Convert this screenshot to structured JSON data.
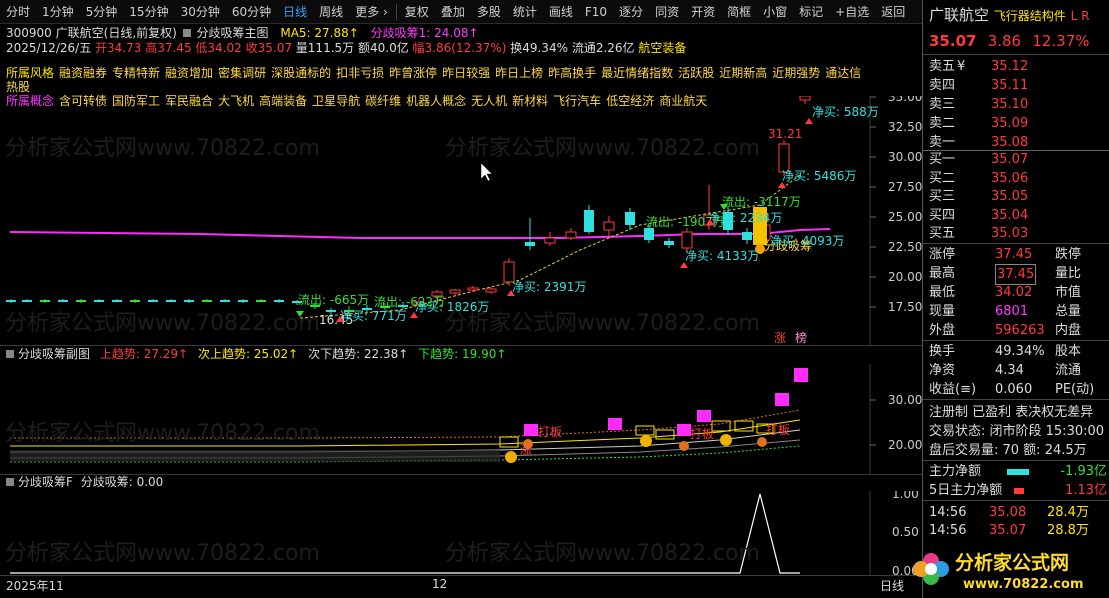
{
  "toolbar": {
    "items": [
      "分时",
      "1分钟",
      "5分钟",
      "15分钟",
      "30分钟",
      "60分钟",
      "日线",
      "周线",
      "更多 ›",
      "复权",
      "叠加",
      "多股",
      "统计",
      "画线",
      "F10",
      "逐分",
      "同资",
      "开资",
      "简框",
      "小窗",
      "标记",
      "+自选",
      "返回"
    ],
    "active_index": 6
  },
  "stock": {
    "code": "300900",
    "name": "广联航空",
    "mode": "(日线,前复权)",
    "date": "2025/12/26/五",
    "open": "开34.73",
    "high": "高37.45",
    "low": "低34.02",
    "close": "收35.07",
    "volume": "量111.5万",
    "amount": "额40.0亿",
    "amplitude": "幅3.86(12.37%)",
    "turnover": "换49.34%",
    "float": "流通2.26亿",
    "sector": "航空装备"
  },
  "main_indicator": {
    "name": "分歧吸筹主图",
    "ma5": "MA5: 27.88↑",
    "xichou": "分歧吸筹1: 24.08↑"
  },
  "concepts_line1": [
    "所属风格",
    "融资融券",
    "专精特新",
    "融资增加",
    "密集调研",
    "深股通标的",
    "扣非亏损",
    "昨曾涨停",
    "昨日较强",
    "昨日上榜",
    "昨高换手",
    "最近情绪指数",
    "活跃股",
    "近期新高",
    "近期强势",
    "通达信热股"
  ],
  "concepts_line2": [
    "所属概念",
    "含可转债",
    "国防军工",
    "军民融合",
    "大飞机",
    "高端装备",
    "卫星导航",
    "碳纤维",
    "机器人概念",
    "无人机",
    "新材料",
    "飞行汽车",
    "低空经济",
    "商业航天"
  ],
  "main_chart": {
    "y_ticks": [
      "35.00",
      "32.50",
      "30.00",
      "27.50",
      "25.00",
      "22.50",
      "20.00",
      "17.50"
    ],
    "annotations": [
      "流出: -665万",
      "流出: -622万",
      "16.45",
      "净买: 771万",
      "净买: 1826万",
      "净买: 2391万",
      "流出: -1907万",
      "净买: 2234万",
      "流出: -3117万",
      "净买: 4133万",
      "净买: 5486万",
      "净买: 588万",
      "31.21",
      "分歧吸筹",
      "净买: 4093万",
      "涨",
      "榜"
    ]
  },
  "sub_indicator": {
    "name": "分歧吸筹副图",
    "up_trend": "上趋势: 27.29↑",
    "next_up": "次上趋势: 25.02↑",
    "next_down": "次下趋势: 22.38↑",
    "down_trend": "下趋势: 19.90↑",
    "y_ticks": [
      "30.00",
      "20.00"
    ],
    "labels": [
      "打板",
      "打板",
      "打板",
      "打板",
      "涨"
    ]
  },
  "f_indicator": {
    "name": "分歧吸筹F",
    "value": "分歧吸筹: 0.00",
    "y_ticks": [
      "1.00",
      "0.50",
      "0.00"
    ]
  },
  "x_axis": {
    "labels": [
      "2025年11",
      "12"
    ],
    "right_label": "日线"
  },
  "watermark": "分析家公式网www.70822.com",
  "logo": {
    "title": "分析家公式网",
    "url": "www.70822.com"
  },
  "quote": {
    "name": "广联航空",
    "tag": "飞行器结构件",
    "flags": "L R",
    "price": "35.07",
    "change": "3.86",
    "pct": "12.37%",
    "asks": [
      {
        "label": "卖五",
        "suffix": "¥",
        "price": "35.12"
      },
      {
        "label": "卖四",
        "suffix": "",
        "price": "35.11"
      },
      {
        "label": "卖三",
        "suffix": "",
        "price": "35.10"
      },
      {
        "label": "卖二",
        "suffix": "",
        "price": "35.09"
      },
      {
        "label": "卖一",
        "suffix": "",
        "price": "35.08"
      }
    ],
    "bids": [
      {
        "label": "买一",
        "price": "35.07"
      },
      {
        "label": "买二",
        "price": "35.06"
      },
      {
        "label": "买三",
        "price": "35.05"
      },
      {
        "label": "买四",
        "price": "35.04"
      },
      {
        "label": "买五",
        "price": "35.03"
      }
    ],
    "stats": [
      {
        "l1": "涨停",
        "v1": "37.45",
        "l2": "跌停",
        "v2": ""
      },
      {
        "l1": "最高",
        "v1": "37.45",
        "l2": "量比",
        "v2": ""
      },
      {
        "l1": "最低",
        "v1": "34.02",
        "l2": "市值",
        "v2": ""
      },
      {
        "l1": "现量",
        "v1": "6801",
        "l2": "总量",
        "v2": ""
      },
      {
        "l1": "外盘",
        "v1": "596263",
        "l2": "内盘",
        "v2": ""
      }
    ],
    "stats2": [
      {
        "l1": "换手",
        "v1": "49.34%",
        "l2": "股本"
      },
      {
        "l1": "净资",
        "v1": "4.34",
        "l2": "流通"
      },
      {
        "l1": "收益(≡)",
        "v1": "0.060",
        "l2": "PE(动)"
      }
    ],
    "registration": "注册制 已盈利 表决权无差异",
    "trade_status": "交易状态: 闭市阶段 15:30:00",
    "after_hours": "盘后交易量: 70  额: 24.5万",
    "main_net": {
      "label": "主力净额",
      "value": "-1.93亿"
    },
    "main_net5": {
      "label": "5日主力净额",
      "value": "1.13亿"
    },
    "ticks": [
      {
        "time": "14:56",
        "price": "35.08",
        "vol": "28.4万"
      },
      {
        "time": "14:56",
        "price": "35.07",
        "vol": "28.8万"
      }
    ]
  }
}
